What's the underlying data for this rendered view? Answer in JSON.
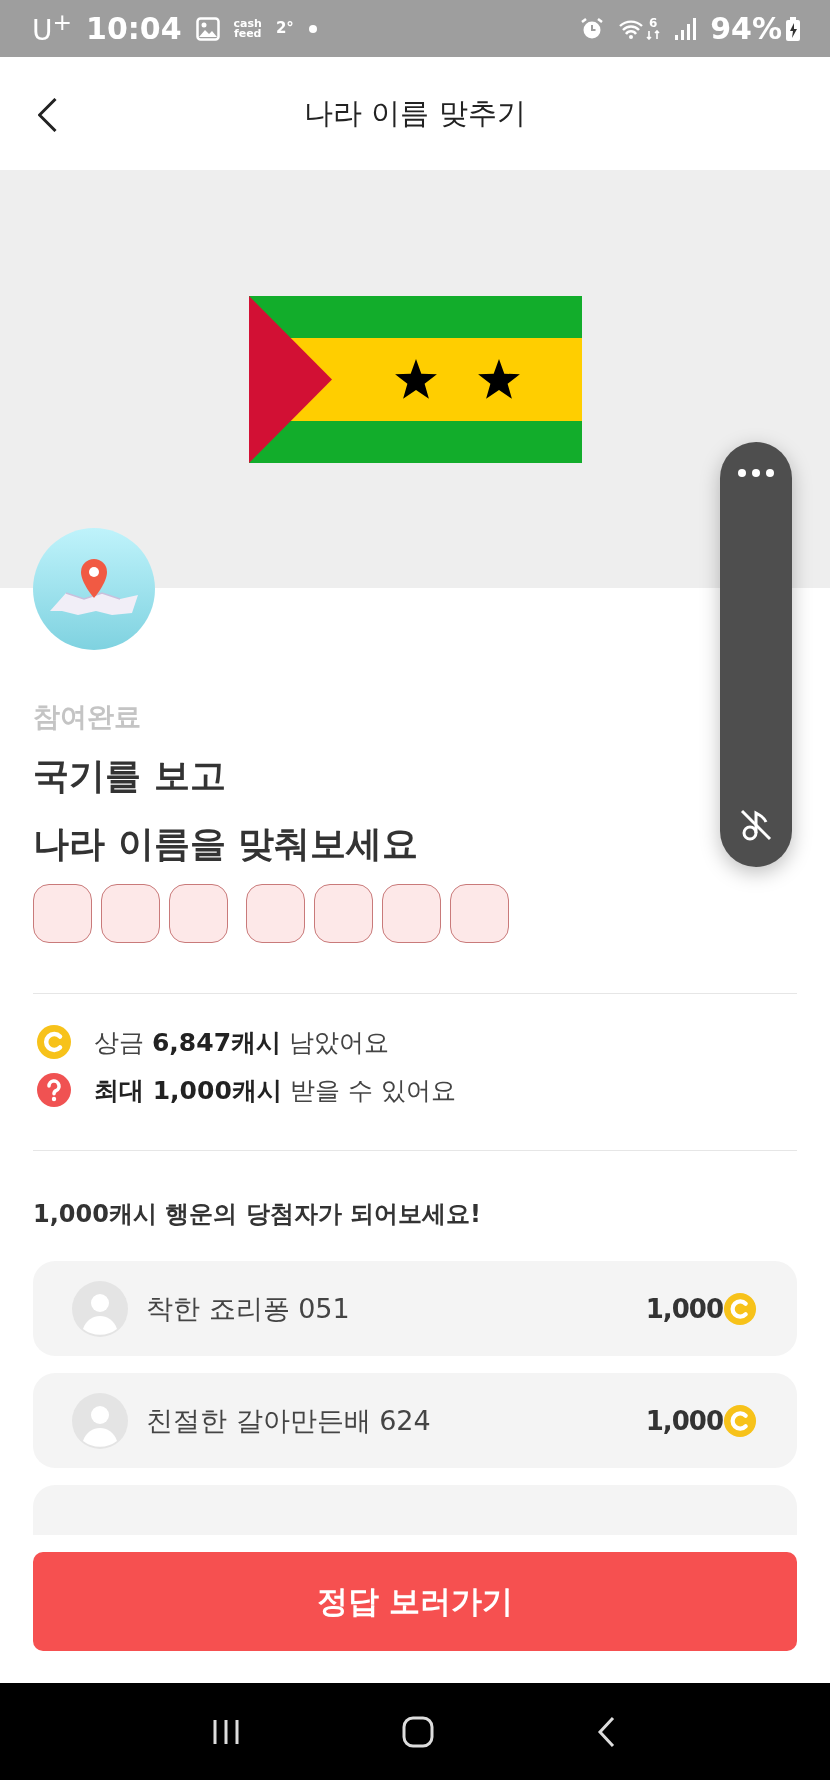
{
  "status_bar": {
    "carrier": "U$^{+}$",
    "time": "10:04",
    "app_badge": [
      "cash",
      "feed"
    ],
    "temperature": "2°",
    "wifi_band": "6",
    "battery": "94%"
  },
  "header": {
    "title": "나라 이름 맞추기"
  },
  "quiz": {
    "status": "참여완료",
    "question_lines": [
      "국기를 보고",
      "나라 이름을 맞춰보세요"
    ],
    "answer_words": [
      {
        "slots": [
          {
            "filled": false
          },
          {
            "filled": false
          },
          {
            "filled": false
          }
        ]
      },
      {
        "slots": [
          {
            "filled": false
          },
          {
            "filled": false
          },
          {
            "filled": false
          },
          {
            "filled": false
          }
        ]
      }
    ]
  },
  "info": [
    {
      "kind": "coin",
      "text": "상금 **6,847캐시** 남았어요"
    },
    {
      "kind": "help",
      "text": "**최대 1,000캐시** 받을 수 있어요"
    }
  ],
  "winners": {
    "heading": "1,000캐시 행운의 당첨자가 되어보세요!",
    "rows": [
      {
        "name": "착한 죠리퐁 051",
        "amount": "1,000"
      },
      {
        "name": "친절한 갈아만든배 624",
        "amount": "1,000"
      }
    ]
  },
  "action_button": "정답 보러가기"
}
